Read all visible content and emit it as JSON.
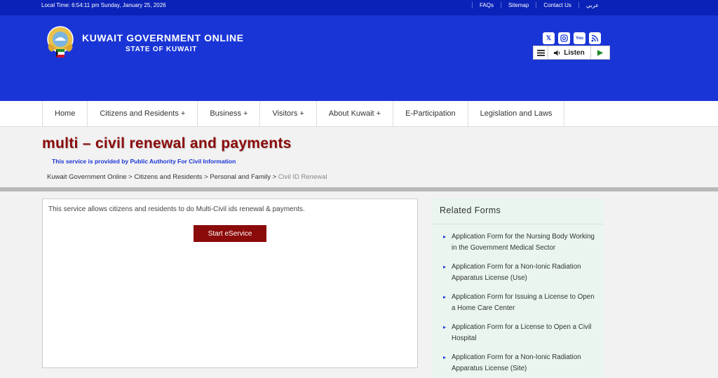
{
  "topbar": {
    "local_time": "Local Time: 6:54:11 pm Sunday, January 25, 2026",
    "links": [
      "FAQs",
      "Sitemap",
      "Contact Us",
      "عربي"
    ]
  },
  "header": {
    "title": "KUWAIT GOVERNMENT ONLINE",
    "subtitle": "STATE OF KUWAIT",
    "social_icons": [
      "x-icon",
      "instagram-icon",
      "youtube-icon",
      "rss-icon"
    ],
    "listen_label": "Listen"
  },
  "nav": {
    "items": [
      "Home",
      "Citizens and Residents +",
      "Business +",
      "Visitors +",
      "About Kuwait +",
      "E-Participation",
      "Legislation and Laws"
    ]
  },
  "page": {
    "title": "multi – civil renewal and payments",
    "provider": "This service is provided by Public Authority For Civil Information",
    "breadcrumb": [
      "Kuwait Government Online",
      "Citizens and Residents",
      "Personal and Family",
      "Civil ID Renewal"
    ]
  },
  "main": {
    "description": "This service allows citizens and residents to do Multi-Civil ids renewal & payments.",
    "start_button": "Start eService"
  },
  "related": {
    "heading": "Related Forms",
    "items": [
      "Application Form for the Nursing Body Working in the Government Medical Sector",
      "Application Form for a Non-Ionic Radiation Apparatus License (Use)",
      "Application Form for Issuing a License to Open a Home Care Center",
      "Application Form for a License to Open a Civil Hospital",
      "Application Form for a Non-Ionic Radiation Apparatus License (Site)"
    ]
  },
  "colors": {
    "header_blue": "#1a35d6",
    "topbar_blue": "#0a22b8",
    "title_red": "#8b0a0a",
    "related_bg": "#e9f5ee"
  }
}
